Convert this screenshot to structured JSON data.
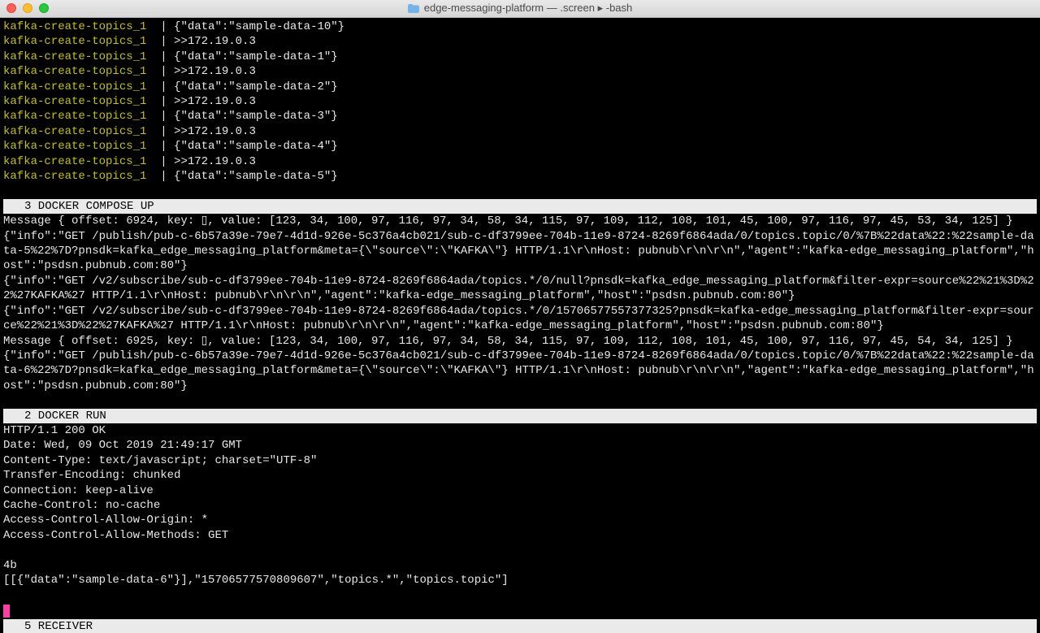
{
  "window": {
    "title": "edge-messaging-platform — .screen ▸ -bash"
  },
  "kafka": {
    "prefix": "kafka-create-topics_1  ",
    "sep": "| ",
    "lines": [
      "{\"data\":\"sample-data-10\"}",
      ">>172.19.0.3",
      "{\"data\":\"sample-data-1\"}",
      ">>172.19.0.3",
      "{\"data\":\"sample-data-2\"}",
      ">>172.19.0.3",
      "{\"data\":\"sample-data-3\"}",
      ">>172.19.0.3",
      "{\"data\":\"sample-data-4\"}",
      ">>172.19.0.3",
      "{\"data\":\"sample-data-5\"}"
    ]
  },
  "sections": {
    "s1": "3 DOCKER COMPOSE UP",
    "s2": "2 DOCKER RUN",
    "s3": "5 RECEIVER"
  },
  "compose": {
    "l1": "Message { offset: 6924, key: ▯, value: [123, 34, 100, 97, 116, 97, 34, 58, 34, 115, 97, 109, 112, 108, 101, 45, 100, 97, 116, 97, 45, 53, 34, 125] }",
    "l2": "{\"info\":\"GET /publish/pub-c-6b57a39e-79e7-4d1d-926e-5c376a4cb021/sub-c-df3799ee-704b-11e9-8724-8269f6864ada/0/topics.topic/0/%7B%22data%22:%22sample-data-5%22%7D?pnsdk=kafka_edge_messaging_platform&meta={\\\"source\\\":\\\"KAFKA\\\"} HTTP/1.1\\r\\nHost: pubnub\\r\\n\\r\\n\",\"agent\":\"kafka-edge_messaging_platform\",\"host\":\"psdsn.pubnub.com:80\"}",
    "l3": "{\"info\":\"GET /v2/subscribe/sub-c-df3799ee-704b-11e9-8724-8269f6864ada/topics.*/0/null?pnsdk=kafka_edge_messaging_platform&filter-expr=source%22%21%3D%22%27KAFKA%27 HTTP/1.1\\r\\nHost: pubnub\\r\\n\\r\\n\",\"agent\":\"kafka-edge_messaging_platform\",\"host\":\"psdsn.pubnub.com:80\"}",
    "l4": "{\"info\":\"GET /v2/subscribe/sub-c-df3799ee-704b-11e9-8724-8269f6864ada/topics.*/0/15706577557377325?pnsdk=kafka-edge_messaging_platform&filter-expr=source%22%21%3D%22%27KAFKA%27 HTTP/1.1\\r\\nHost: pubnub\\r\\n\\r\\n\",\"agent\":\"kafka-edge_messaging_platform\",\"host\":\"psdsn.pubnub.com:80\"}",
    "l5": "Message { offset: 6925, key: ▯, value: [123, 34, 100, 97, 116, 97, 34, 58, 34, 115, 97, 109, 112, 108, 101, 45, 100, 97, 116, 97, 45, 54, 34, 125] }",
    "l6": "{\"info\":\"GET /publish/pub-c-6b57a39e-79e7-4d1d-926e-5c376a4cb021/sub-c-df3799ee-704b-11e9-8724-8269f6864ada/0/topics.topic/0/%7B%22data%22:%22sample-data-6%22%7D?pnsdk=kafka_edge_messaging_platform&meta={\\\"source\\\":\\\"KAFKA\\\"} HTTP/1.1\\r\\nHost: pubnub\\r\\n\\r\\n\",\"agent\":\"kafka-edge_messaging_platform\",\"host\":\"psdsn.pubnub.com:80\"}"
  },
  "run": {
    "l1": "HTTP/1.1 200 OK",
    "l2": "Date: Wed, 09 Oct 2019 21:49:17 GMT",
    "l3": "Content-Type: text/javascript; charset=\"UTF-8\"",
    "l4": "Transfer-Encoding: chunked",
    "l5": "Connection: keep-alive",
    "l6": "Cache-Control: no-cache",
    "l7": "Access-Control-Allow-Origin: *",
    "l8": "Access-Control-Allow-Methods: GET",
    "l9": "4b",
    "l10": "[[{\"data\":\"sample-data-6\"}],\"15706577570809607\",\"topics.*\",\"topics.topic\"]"
  }
}
